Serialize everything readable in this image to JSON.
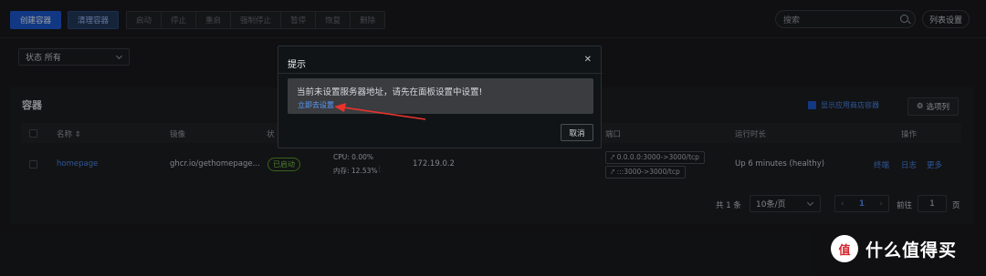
{
  "toolbar": {
    "create": "创建容器",
    "prune": "清理容器",
    "actions": [
      "启动",
      "停止",
      "重启",
      "强制停止",
      "暂停",
      "恢复",
      "删除"
    ],
    "search_placeholder": "搜索",
    "list_settings": "列表设置"
  },
  "filter": {
    "status": "状态 所有"
  },
  "containers": {
    "title": "容器",
    "show_app": "显示应用商店容器",
    "columns_btn": "选项列",
    "headers": {
      "name": "名称",
      "image": "镜像",
      "status": "状",
      "ports": "端口",
      "uptime": "运行时长",
      "actions": "操作"
    },
    "row": {
      "name": "homepage",
      "image": "ghcr.io/gethomepage...",
      "state": "已启动",
      "cpu": "CPU: 0.00%",
      "mem": "内存: 12.53%",
      "ip": "172.19.0.2",
      "port1": "0.0.0.0:3000->3000/tcp",
      "port2": ":::3000->3000/tcp",
      "uptime": "Up 6 minutes (healthy)",
      "op1": "终端",
      "op2": "日志",
      "op3": "更多"
    },
    "pagination": {
      "total": "共 1 条",
      "size": "10条/页",
      "page": "1",
      "goto": "前往",
      "goto_val": "1",
      "unit": "页"
    }
  },
  "modal": {
    "title": "提示",
    "message": "当前未设置服务器地址，请先在面板设置中设置!",
    "link": "立即去设置",
    "cancel": "取消"
  },
  "watermark": {
    "logo": "值",
    "text": "什么值得买"
  },
  "colors": {
    "accent": "#1d5bd6",
    "link": "#4d8cf5",
    "success": "#7dcb4b",
    "arrow": "#e8332b"
  }
}
